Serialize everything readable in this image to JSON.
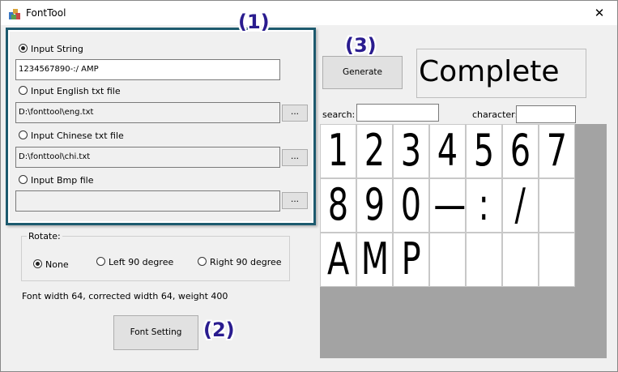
{
  "window": {
    "title": "FontTool"
  },
  "source": {
    "input_string_label": "Input String",
    "input_string_value": "1234567890-:/ AMP",
    "english_label": "Input English txt file",
    "english_path": "D:\\fonttool\\eng.txt",
    "chinese_label": "Input Chinese txt file",
    "chinese_path": "D:\\fonttool\\chi.txt",
    "bmp_label": "Input Bmp file",
    "bmp_path": "",
    "browse_label": "...",
    "selected": "input_string"
  },
  "rotate": {
    "label": "Rotate:",
    "options": [
      "None",
      "Left 90 degree",
      "Right 90 degree"
    ],
    "selected": "None"
  },
  "font_info": "Font width 64, corrected width 64,  weight 400",
  "font_setting_label": "Font Setting",
  "generate_label": "Generate",
  "status_text": "Complete",
  "search": {
    "label": "search:",
    "value": ""
  },
  "character": {
    "label": "character:",
    "value": ""
  },
  "callouts": [
    "(1)",
    "(2)",
    "(3)"
  ],
  "glyph_rows": [
    [
      "1",
      "2",
      "3",
      "4",
      "5",
      "6",
      "7"
    ],
    [
      "8",
      "9",
      "0",
      "—",
      ":",
      "/",
      ""
    ],
    [
      "A",
      "M",
      "P",
      "",
      "",
      "",
      ""
    ]
  ],
  "colors": {
    "panel_border": "#1d5a6e",
    "callout_text": "#2a1c8f",
    "grid_background": "#a3a3a3"
  }
}
